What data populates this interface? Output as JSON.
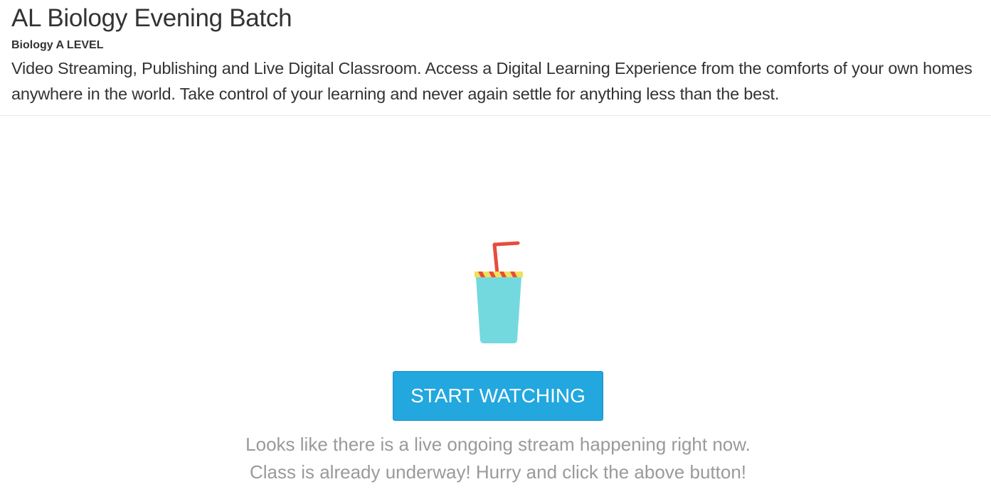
{
  "header": {
    "title": "AL Biology Evening Batch",
    "subtitle": "Biology A LEVEL",
    "description": "Video Streaming, Publishing and Live Digital Classroom. Access a Digital Learning Experience from the comforts of your own homes anywhere in the world. Take control of your learning and never again settle for anything less than the best."
  },
  "main": {
    "illustration_icon": "drink-cup-icon",
    "start_button_label": "START WATCHING",
    "status_line_1": "Looks like there is a live ongoing stream happening right now.",
    "status_line_2": "Class is already underway! Hurry and click the above button!"
  },
  "colors": {
    "button_background": "#22a7df",
    "button_text": "#ffffff",
    "status_text": "#9a9a9a",
    "cup_body": "#74d9df",
    "straw": "#e84c3d",
    "lid_stripe": "#f0e15a"
  }
}
